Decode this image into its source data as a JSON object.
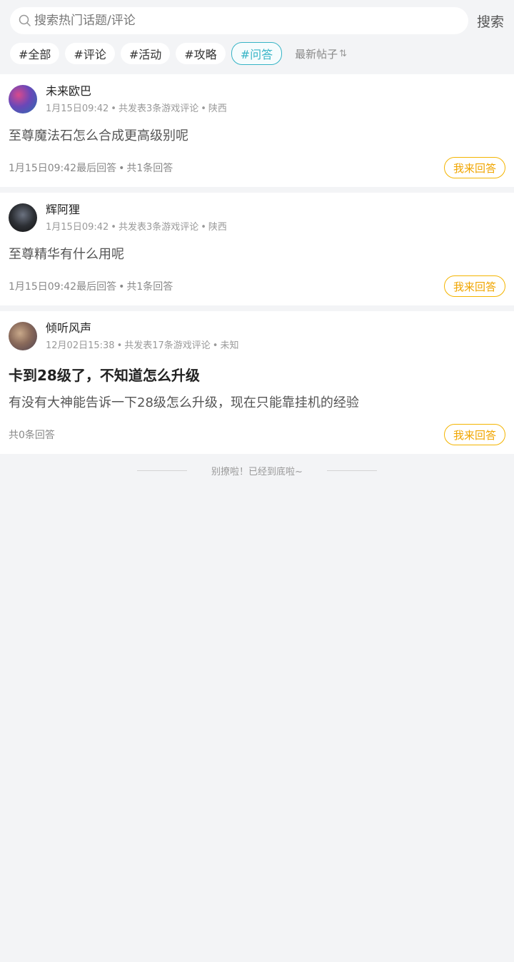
{
  "search": {
    "placeholder": "搜索热门话题/评论",
    "button_label": "搜索"
  },
  "tags": [
    {
      "label": "#全部",
      "active": false
    },
    {
      "label": "#评论",
      "active": false
    },
    {
      "label": "#活动",
      "active": false
    },
    {
      "label": "#攻略",
      "active": false
    },
    {
      "label": "#问答",
      "active": true
    }
  ],
  "sort": {
    "label": "最新帖子",
    "icon": "⇅"
  },
  "posts": [
    {
      "username": "未来欧巴",
      "time": "1月15日09:42",
      "stats": "共发表3条游戏评论",
      "location": "陕西",
      "title": "",
      "content": "至尊魔法石怎么合成更高级别呢",
      "last_reply": "1月15日09:42最后回答",
      "answer_count": "共1条回答",
      "answer_button": "我来回答"
    },
    {
      "username": "辉阿狸",
      "time": "1月15日09:42",
      "stats": "共发表3条游戏评论",
      "location": "陕西",
      "title": "",
      "content": "至尊精华有什么用呢",
      "last_reply": "1月15日09:42最后回答",
      "answer_count": "共1条回答",
      "answer_button": "我来回答"
    },
    {
      "username": "倾听风声",
      "time": "12月02日15:38",
      "stats": "共发表17条游戏评论",
      "location": "未知",
      "title": "卡到28级了，不知道怎么升级",
      "content": "有没有大神能告诉一下28级怎么升级，现在只能靠挂机的经验",
      "last_reply": "",
      "answer_count": "共0条回答",
      "answer_button": "我来回答"
    }
  ],
  "end_text": "别撩啦！已经到底啦~",
  "colors": {
    "accent": "#36b4c6",
    "answer": "#f4b400",
    "background": "#f3f4f6"
  }
}
